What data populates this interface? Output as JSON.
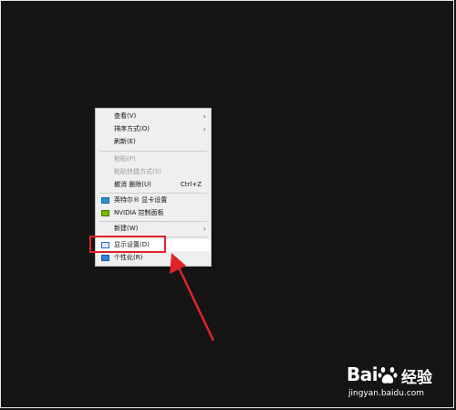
{
  "context_menu": {
    "items": [
      {
        "label": "查看(V)",
        "submenu": true,
        "disabled": false
      },
      {
        "label": "排序方式(O)",
        "submenu": true,
        "disabled": false
      },
      {
        "label": "刷新(E)",
        "submenu": false,
        "disabled": false
      },
      {
        "label": "粘贴(P)",
        "submenu": false,
        "disabled": true
      },
      {
        "label": "粘贴快捷方式(S)",
        "submenu": false,
        "disabled": true
      },
      {
        "label": "撤消 删除(U)",
        "shortcut": "Ctrl+Z",
        "submenu": false,
        "disabled": false
      },
      {
        "label": "英特尔® 显卡设置",
        "icon": "intel-graphics-icon",
        "submenu": false,
        "disabled": false
      },
      {
        "label": "NVIDIA 控制面板",
        "icon": "nvidia-icon",
        "submenu": false,
        "disabled": false
      },
      {
        "label": "新建(W)",
        "submenu": true,
        "disabled": false
      },
      {
        "label": "显示设置(D)",
        "icon": "display-settings-icon",
        "submenu": false,
        "disabled": false,
        "hovered": true
      },
      {
        "label": "个性化(R)",
        "icon": "personalize-icon",
        "submenu": false,
        "disabled": false
      }
    ],
    "submenu_arrow": "›"
  },
  "annotation": {
    "highlight_color": "#e0242a",
    "arrow_color": "#e0242a"
  },
  "watermark": {
    "brand": "Bai",
    "brand_cn": "经验",
    "url": "jingyan.baidu.com"
  },
  "colors": {
    "desktop_bg": "#151515",
    "menu_bg": "#efefef",
    "disabled_text": "#9a9a9a"
  }
}
